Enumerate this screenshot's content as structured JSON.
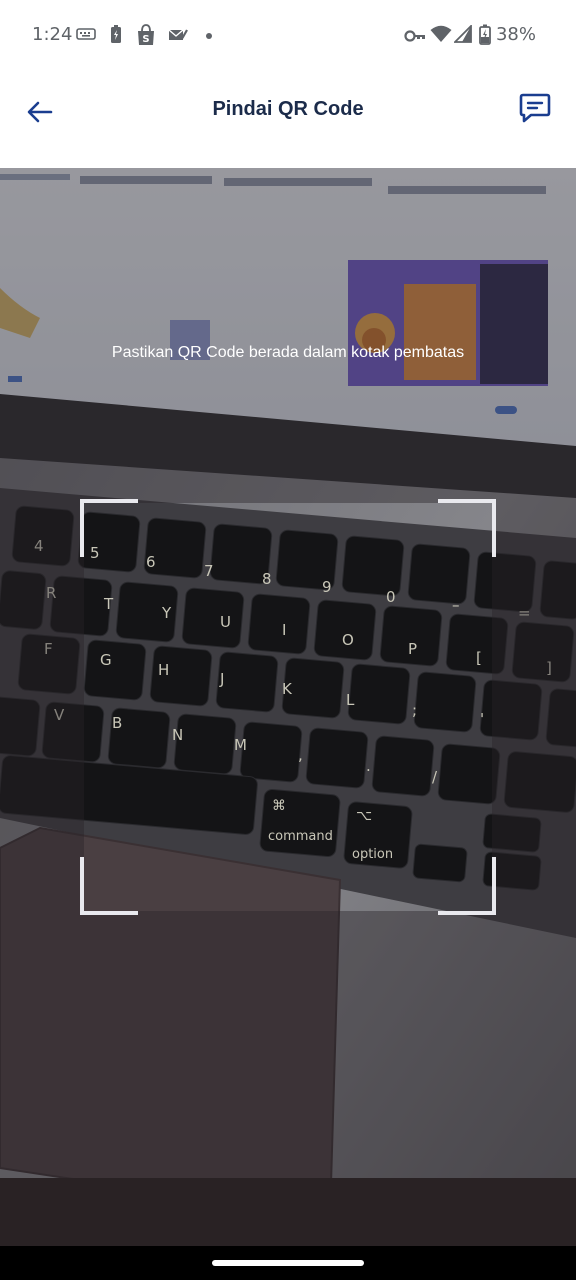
{
  "status_bar": {
    "time": "1:24",
    "battery": "38%",
    "icons": [
      "keyboard-icon",
      "battery-saver-icon",
      "shopee-icon",
      "mail-check-icon",
      "dot-icon",
      "vpn-key-icon",
      "wifi-icon",
      "cellular-signal-icon",
      "battery-charging-icon"
    ]
  },
  "app_bar": {
    "title": "Pindai QR Code",
    "back_icon": "arrow-back-icon",
    "chat_icon": "chat-icon"
  },
  "scanner": {
    "hint": "Pastikan QR Code berada dalam kotak pembatas"
  },
  "colors": {
    "accent": "#1a3d8f",
    "title": "#1b2b4a",
    "frame": "#e9e9ee"
  }
}
